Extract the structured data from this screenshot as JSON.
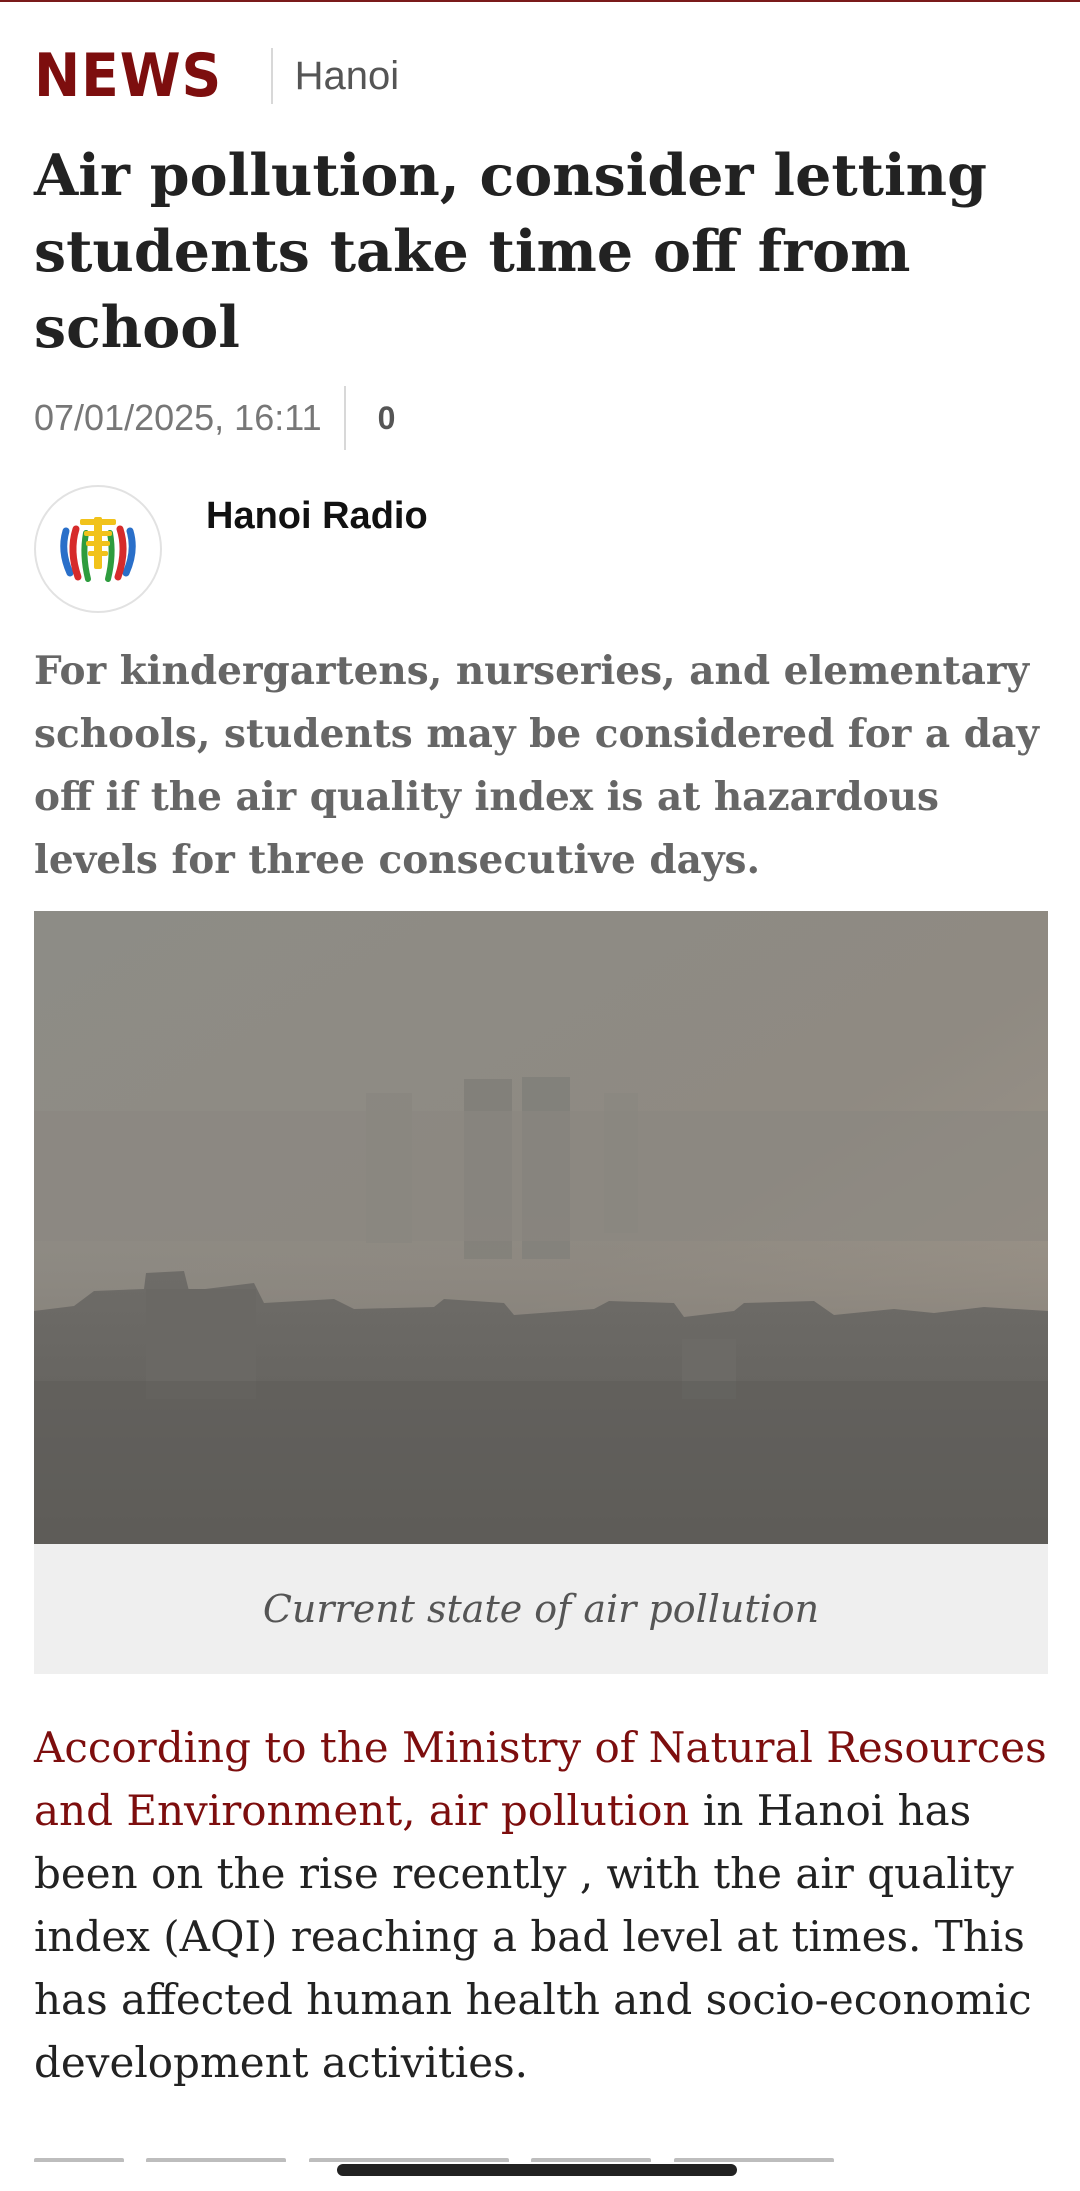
{
  "header": {
    "brand": "NEWS",
    "section": "Hanoi"
  },
  "article": {
    "title": "Air pollution, consider letting students take time off from school",
    "datetime": "07/01/2025, 16:11",
    "comment_count": "0",
    "author": {
      "name": "Hanoi Radio",
      "logo_icon": "hanoi-radio-logo-icon"
    },
    "sapo": "For kindergartens, nurseries, and elementary schools, students may be considered for a day off if the air quality index is at hazardous levels for three consecutive days.",
    "image": {
      "caption": "Current state of air pollution"
    },
    "body": {
      "p1_link": "According to the Ministry of Natural Resources and Environment, air pollution",
      "p1_text": " in Hanoi has been on the rise recently , with the air quality index (AQI) reaching a bad level at times. This has affected human health and socio-economic development activities."
    }
  },
  "colors": {
    "brand": "#7d0e0e",
    "link": "#7d0e0e",
    "caption_bg": "#efefef"
  }
}
